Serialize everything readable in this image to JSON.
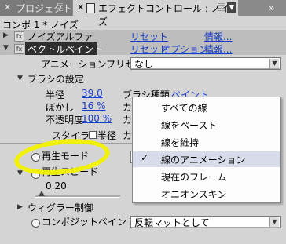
{
  "tabs": [
    {
      "label": "プロジェクト"
    },
    {
      "label": "エフェクトコントロール : ノイズ"
    }
  ],
  "breadcrumb": "コンポ 1 * ノイズ",
  "effects": {
    "noise_alpha": {
      "label": "ノイズアルファ",
      "reset": "リセット",
      "info": "情報..."
    },
    "vector_paint": {
      "label": "ベクトルペイント",
      "reset": "リセット",
      "options": "オプション...",
      "info": "情報..."
    }
  },
  "animation_preset": {
    "label": "アニメーションプリセット :",
    "value": "なし"
  },
  "brush_settings": {
    "label": "ブラシの設定",
    "radius_label": "半径",
    "radius_value": "39.0",
    "feather_label": "ぼかし",
    "feather_value": "16 %",
    "opacity_label": "不透明度",
    "opacity_value": "100 %",
    "brush_type_label": "ブラシ種類",
    "brush_type_value": "ペイント",
    "color_label_1": "カ",
    "color_label_2": "カ",
    "color_label_3": "カ",
    "stylus_label": "スタイラス :",
    "stylus_value": "半径"
  },
  "playback_mode": {
    "label": "再生モード"
  },
  "playback_speed": {
    "label": "再生スピード",
    "value": "0.20"
  },
  "wiggle": {
    "label": "ウィグラー制御"
  },
  "composite": {
    "label": "コンポジットペイント",
    "value": "反転マットとして"
  },
  "popup_menu": {
    "items": [
      {
        "label": "すべての線",
        "checked": false
      },
      {
        "label": "線をペースト",
        "checked": false
      },
      {
        "label": "線を維持",
        "checked": false
      },
      {
        "label": "線のアニメーション",
        "checked": true
      },
      {
        "label": "現在のフレーム",
        "checked": false
      },
      {
        "label": "オニオンスキン",
        "checked": false
      }
    ],
    "check_glyph": "✓"
  },
  "colors": {
    "link": "#1a3cc8",
    "highlight": "#f2f200",
    "selected_bg": "#2e2e2e"
  }
}
